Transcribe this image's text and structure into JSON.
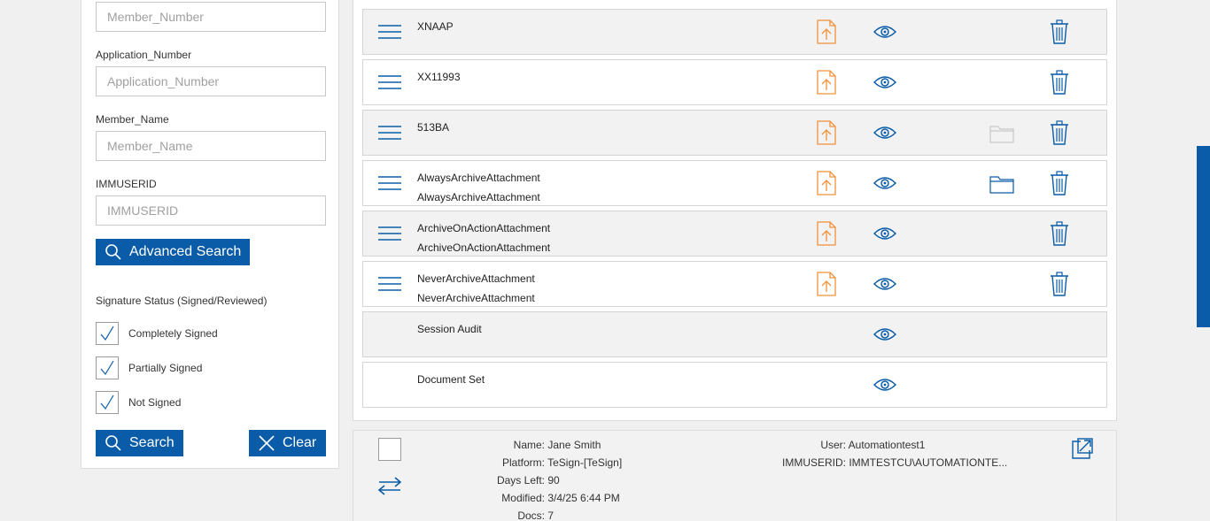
{
  "search": {
    "fields": [
      {
        "label": "",
        "placeholder": "Member_Number"
      },
      {
        "label": "Application_Number",
        "placeholder": "Application_Number"
      },
      {
        "label": "Member_Name",
        "placeholder": "Member_Name"
      },
      {
        "label": "IMMUSERID",
        "placeholder": "IMMUSERID"
      }
    ],
    "advanced_search_label": "Advanced Search",
    "signature_status_title": "Signature Status (Signed/Reviewed)",
    "signature_options": [
      {
        "label": "Completely Signed",
        "checked": true
      },
      {
        "label": "Partially Signed",
        "checked": true
      },
      {
        "label": "Not Signed",
        "checked": true
      }
    ],
    "search_label": "Search",
    "clear_label": "Clear"
  },
  "documents": [
    {
      "line1": "XNAAP",
      "line2": "",
      "has_handle": true,
      "has_upload": true,
      "has_folder": false,
      "folder_active": false,
      "has_trash": true
    },
    {
      "line1": "XX11993",
      "line2": "",
      "has_handle": true,
      "has_upload": true,
      "has_folder": false,
      "folder_active": false,
      "has_trash": true
    },
    {
      "line1": "513BA",
      "line2": "",
      "has_handle": true,
      "has_upload": true,
      "has_folder": true,
      "folder_active": false,
      "has_trash": true
    },
    {
      "line1": "AlwaysArchiveAttachment",
      "line2": "AlwaysArchiveAttachment",
      "has_handle": true,
      "has_upload": true,
      "has_folder": true,
      "folder_active": true,
      "has_trash": true
    },
    {
      "line1": "ArchiveOnActionAttachment",
      "line2": "ArchiveOnActionAttachment",
      "has_handle": true,
      "has_upload": true,
      "has_folder": false,
      "folder_active": false,
      "has_trash": true
    },
    {
      "line1": "NeverArchiveAttachment",
      "line2": "NeverArchiveAttachment",
      "has_handle": true,
      "has_upload": true,
      "has_folder": false,
      "folder_active": false,
      "has_trash": true
    },
    {
      "line1": "Session Audit",
      "line2": "",
      "has_handle": false,
      "has_upload": false,
      "has_folder": false,
      "folder_active": false,
      "has_trash": false
    },
    {
      "line1": "Document Set",
      "line2": "",
      "has_handle": false,
      "has_upload": false,
      "has_folder": false,
      "folder_active": false,
      "has_trash": false
    }
  ],
  "session": {
    "left": [
      {
        "key": "Name:",
        "value": "Jane Smith"
      },
      {
        "key": "Platform:",
        "value": "TeSign-[TeSign]"
      },
      {
        "key": "Days Left:",
        "value": "90"
      },
      {
        "key": "Modified:",
        "value": "3/4/25 6:44 PM"
      },
      {
        "key": "Docs:",
        "value": "7"
      }
    ],
    "right": [
      {
        "key": "User:",
        "value": "Automationtest1"
      },
      {
        "key": "IMMUSERID:",
        "value": "IMMTESTCU\\AUTOMATIONTE..."
      }
    ]
  },
  "icons": {
    "accent": "#0b5ca8",
    "upload_color": "#f0913a",
    "folder_inactive": "#c8c8c8"
  }
}
